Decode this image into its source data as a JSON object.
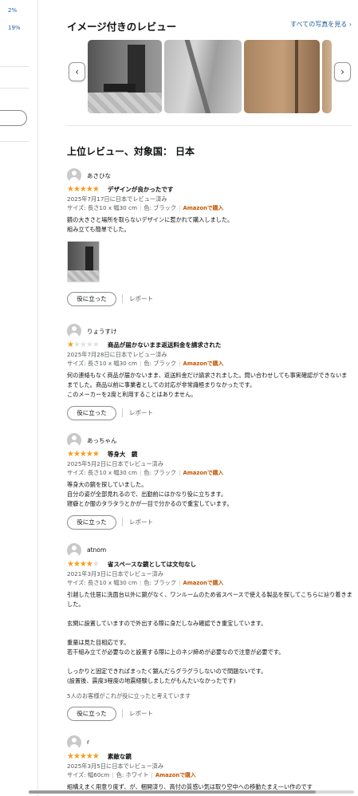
{
  "left_panel": {
    "percent_1": "2%",
    "percent_2": "19%"
  },
  "image_reviews": {
    "title": "イメージ付きのレビュー",
    "see_all_link": "すべての写真を見る ›",
    "prev_icon": "chevron-left-icon",
    "next_icon": "chevron-right-icon"
  },
  "top_reviews": {
    "title": "上位レビュー、対象国： 日本"
  },
  "reviews": [
    {
      "name": "あさひな",
      "rating": 5,
      "title": "デザインが良かったです",
      "date": "2025年7月17日に日本でレビュー済み",
      "size": "サイズ: 長さ10 x 幅30 cm",
      "color": "色: ブラック",
      "verified": "Amazonで購入",
      "body": [
        "鏡の大きさと場所を取らないデザインに惹かれて購入しました。",
        "組み立ても簡単でした。"
      ],
      "helpful_button": "役に立った",
      "report": "レポート"
    },
    {
      "name": "りょうすけ",
      "rating": 1,
      "title": "商品が届かないまま返送料金を請求された",
      "date": "2025年7月28日に日本でレビュー済み",
      "size": "サイズ: 長さ10 x 幅30 cm",
      "color": "色: ブラック",
      "verified": "Amazonで購入",
      "body": [
        "何の連絡もなく商品が届かないまま、返送料金だけ請求されました。問い合わせしても事実確認ができないままでした。商品以前に事業者としての対応が非常識極まりなかったです。",
        "このメーカーを2度と利用することはありません。"
      ],
      "helpful_button": "役に立った",
      "report": "レポート"
    },
    {
      "name": "あっちゃん",
      "rating": 5,
      "title": "等身大　鏡",
      "date": "2025年5月2日に日本でレビュー済み",
      "size": "サイズ: 長さ10 x 幅30 cm",
      "color": "色: ブラック",
      "verified": "Amazonで購入",
      "body": [
        "等身大の鏡を探していました。",
        "自分の姿が全部見れるので、出勤前にはかなり役に立ちます。",
        "寝癖とか服のタラタラとかが一目で分かるので重宝しています。"
      ],
      "helpful_button": "役に立った",
      "report": "レポート"
    },
    {
      "name": "atnom",
      "rating": 4,
      "title": "省スペースな鏡としては文句なし",
      "date": "2021年3月3日に日本でレビュー済み",
      "size": "サイズ: 長さ10 x 幅30 cm",
      "color": "色: ブラック",
      "verified": "Amazonで購入",
      "body": [
        "引越した住居に洗面台以外に鏡がなく、ワンルームのため省スペースで使える製品を探してこちらに辿り着きました。",
        "",
        "玄関に設置していますので外出する際に身だしなみ確認でき重宝しています。",
        "",
        "重量は見た目相応です。",
        "若干組み立てが必要なのと設置する際に上のネジ締めが必要なので注意が必要です。",
        "",
        "しっかりと固定できればまったく鏡んだらグラグラしないので問題ないです。",
        "(設置後、震度3程度の地震経験しましたがもんたいなかったです)"
      ],
      "helpful_count": "5人のお客様がこれが役に立ったと考えています",
      "helpful_button": "役に立った",
      "report": "レポート"
    },
    {
      "name": "r",
      "rating": 5,
      "title": "素敵な鏡",
      "date": "2025年3月5日に日本でレビュー済み",
      "size": "サイズ: 幅60cm",
      "color": "色: ホワイト",
      "verified": "Amazonで購入",
      "body": [
        "組構えまく用意り度ず、が、梱開済り、高付の質感い気は取り空中への移動たまえ一い作のです"
      ]
    }
  ]
}
